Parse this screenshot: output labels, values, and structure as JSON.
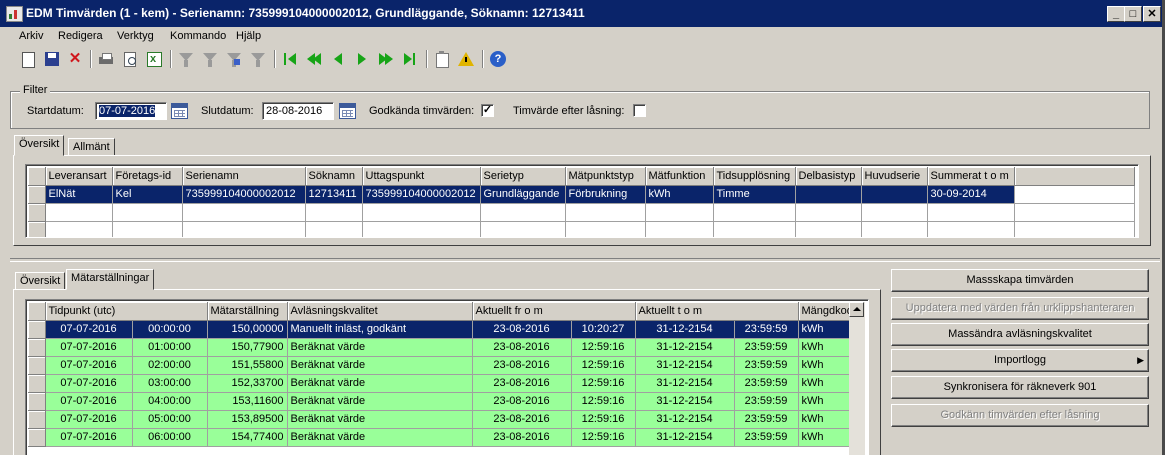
{
  "window": {
    "title": "EDM Timvärden (1 - kem) - Serienamn: 735999104000002012, Grundläggande, Söknamn: 12713411",
    "buttons": {
      "minimize": "_",
      "maximize": "□",
      "close": "✕"
    }
  },
  "menu": [
    "Arkiv",
    "Redigera",
    "Verktyg",
    "Kommando",
    "Hjälp"
  ],
  "toolbar": {
    "icons": [
      "new-icon",
      "save-icon",
      "delete-icon",
      "print-icon",
      "print-preview-icon",
      "excel-export-icon",
      "filter-icon",
      "filter-by-selection-icon",
      "advanced-filter-icon",
      "remove-filter-icon",
      "first-record-icon",
      "previous-page-icon",
      "previous-record-icon",
      "next-record-icon",
      "next-page-icon",
      "last-record-icon",
      "clipboard-icon",
      "alert-icon",
      "help-icon"
    ]
  },
  "filter": {
    "legend": "Filter",
    "start_label": "Startdatum:",
    "start_value": "07-07-2016",
    "end_label": "Slutdatum:",
    "end_value": "28-08-2016",
    "approved_label": "Godkända timvärden:",
    "approved_checked": "✓",
    "after_lock_label": "Timvärde efter låsning:",
    "after_lock_checked": ""
  },
  "top_tabs": [
    "Översikt",
    "Allmänt"
  ],
  "series_grid": {
    "columns": [
      "Leveransart",
      "Företags-id",
      "Serienamn",
      "Söknamn",
      "Uttagspunkt",
      "Serietyp",
      "Mätpunktstyp",
      "Mätfunktion",
      "Tidsupplösning",
      "Delbasistyp",
      "Huvudserie",
      "Summerat t o m"
    ],
    "rows": [
      [
        "ElNät",
        "Kel",
        "735999104000002012",
        "12713411",
        "735999104000002012",
        "Grundläggande",
        "Förbrukning",
        "kWh",
        "Timme",
        "",
        "",
        "30-09-2014"
      ]
    ]
  },
  "bottom_tabs": [
    "Översikt",
    "Mätarställningar"
  ],
  "readings_grid": {
    "columns": [
      "Tidpunkt (utc)",
      "Mätarställning",
      "Avläsningskvalitet",
      "Aktuellt fr o m",
      "Aktuellt t o m",
      "Mängdkod"
    ],
    "rows": [
      [
        "07-07-2016",
        "00:00:00",
        "150,00000",
        "Manuellt inläst, godkänt",
        "23-08-2016",
        "10:20:27",
        "31-12-2154",
        "23:59:59",
        "kWh"
      ],
      [
        "07-07-2016",
        "01:00:00",
        "150,77900",
        "Beräknat värde",
        "23-08-2016",
        "12:59:16",
        "31-12-2154",
        "23:59:59",
        "kWh"
      ],
      [
        "07-07-2016",
        "02:00:00",
        "151,55800",
        "Beräknat värde",
        "23-08-2016",
        "12:59:16",
        "31-12-2154",
        "23:59:59",
        "kWh"
      ],
      [
        "07-07-2016",
        "03:00:00",
        "152,33700",
        "Beräknat värde",
        "23-08-2016",
        "12:59:16",
        "31-12-2154",
        "23:59:59",
        "kWh"
      ],
      [
        "07-07-2016",
        "04:00:00",
        "153,11600",
        "Beräknat värde",
        "23-08-2016",
        "12:59:16",
        "31-12-2154",
        "23:59:59",
        "kWh"
      ],
      [
        "07-07-2016",
        "05:00:00",
        "153,89500",
        "Beräknat värde",
        "23-08-2016",
        "12:59:16",
        "31-12-2154",
        "23:59:59",
        "kWh"
      ],
      [
        "07-07-2016",
        "06:00:00",
        "154,77400",
        "Beräknat värde",
        "23-08-2016",
        "12:59:16",
        "31-12-2154",
        "23:59:59",
        "kWh"
      ]
    ]
  },
  "actions": [
    {
      "label": "Massskapa timvärden",
      "enabled": true
    },
    {
      "label": "Uppdatera med värden från urklippshanteraren",
      "enabled": false
    },
    {
      "label": "Massändra avläsningskvalitet",
      "enabled": true
    },
    {
      "label": "Importlogg",
      "enabled": true,
      "submenu": "▶"
    },
    {
      "label": "Synkronisera för räkneverk 901",
      "enabled": true
    },
    {
      "label": "Godkänn timvärden efter låsning",
      "enabled": false
    }
  ],
  "colors": {
    "selection": "#0a246a",
    "green_row": "#99ff99",
    "face": "#d4d0c8"
  }
}
